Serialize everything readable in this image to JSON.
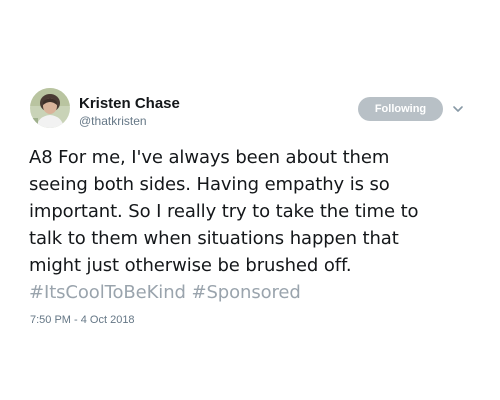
{
  "author": {
    "display_name": "Kristen Chase",
    "handle": "@thatkristen",
    "avatar_icon": "user-avatar-photo"
  },
  "actions": {
    "follow_label": "Following",
    "follow_button_color": "#b8c0c6",
    "menu_icon": "chevron-down-icon"
  },
  "tweet": {
    "text_lines": [
      "A8 For me, I've always been about them",
      "seeing both sides. Having empathy is so",
      "important. So I really try to take the time to",
      "talk to them when situations happen that",
      "might just otherwise be brushed off."
    ],
    "hashtags": [
      "#ItsCoolToBeKind",
      "#Sponsored"
    ],
    "hashtag_color": "#9aa4ad",
    "timestamp": "7:50 PM - 4 Oct 2018"
  }
}
